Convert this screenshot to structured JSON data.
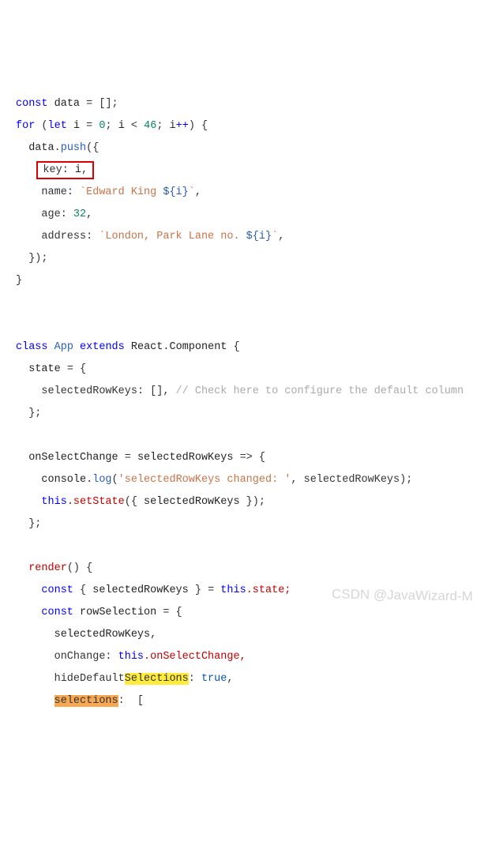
{
  "code": {
    "const": "const",
    "data": "data",
    "eq": " = ",
    "emptyArr": "[];",
    "for": "for",
    "let": "let",
    "i": "i",
    "zero": "0",
    "lt": " < ",
    "fortySix": "46",
    "semi": ";",
    "inc1": " i",
    "inc2": "++",
    "push": "push",
    "openParenBrace": "({",
    "keyLabel": "key",
    "colonSp": ": ",
    "keyVal": "i",
    "comma": ",",
    "nameLabel": "name",
    "nameStr1": "`Edward King ",
    "interp1": "${i}",
    "nameStr2": "`",
    "ageLabel": "age",
    "ageVal": "32",
    "addrLabel": "address",
    "addrStr1": "`London, Park Lane no. ",
    "interp2": "${i}",
    "addrStr2": "`",
    "closeObjCall": "});",
    "closeBrace": "}",
    "class": "class",
    "App": "App",
    "extends": "extends",
    "React": "React",
    "dot": ".",
    "Component": "Component",
    "openBrace": " {",
    "state": "state",
    "selectedRowKeys": "selectedRowKeys",
    "emptyArrComma": "[], ",
    "comment": "// Check here to configure the default column",
    "closeBraceSemi": "};",
    "onSelectChange": "onSelectChange",
    "arrow": " => {",
    "console": "console",
    "log": "log",
    "logStr": "'selectedRowKeys changed: '",
    "logArg": ", selectedRowKeys);",
    "this": "this",
    "setState": "setState",
    "setStateArgOpen": "({ ",
    "setStateArgClose": " });",
    "render": "render",
    "renderParens": "()",
    "destructOpen": "{ ",
    "destructClose": " } = ",
    "thisState": ".state;",
    "rowSelection": "rowSelection",
    "eqBrace": " = {",
    "onChange": "onChange",
    "thisOnSel": ".onSelectChange,",
    "hideDefault": "hideDefault",
    "Selections": "Selections",
    "true": "true",
    "selections": "selections",
    "openBracket": " ["
  },
  "watermark": "CSDN @JavaWizard-M"
}
